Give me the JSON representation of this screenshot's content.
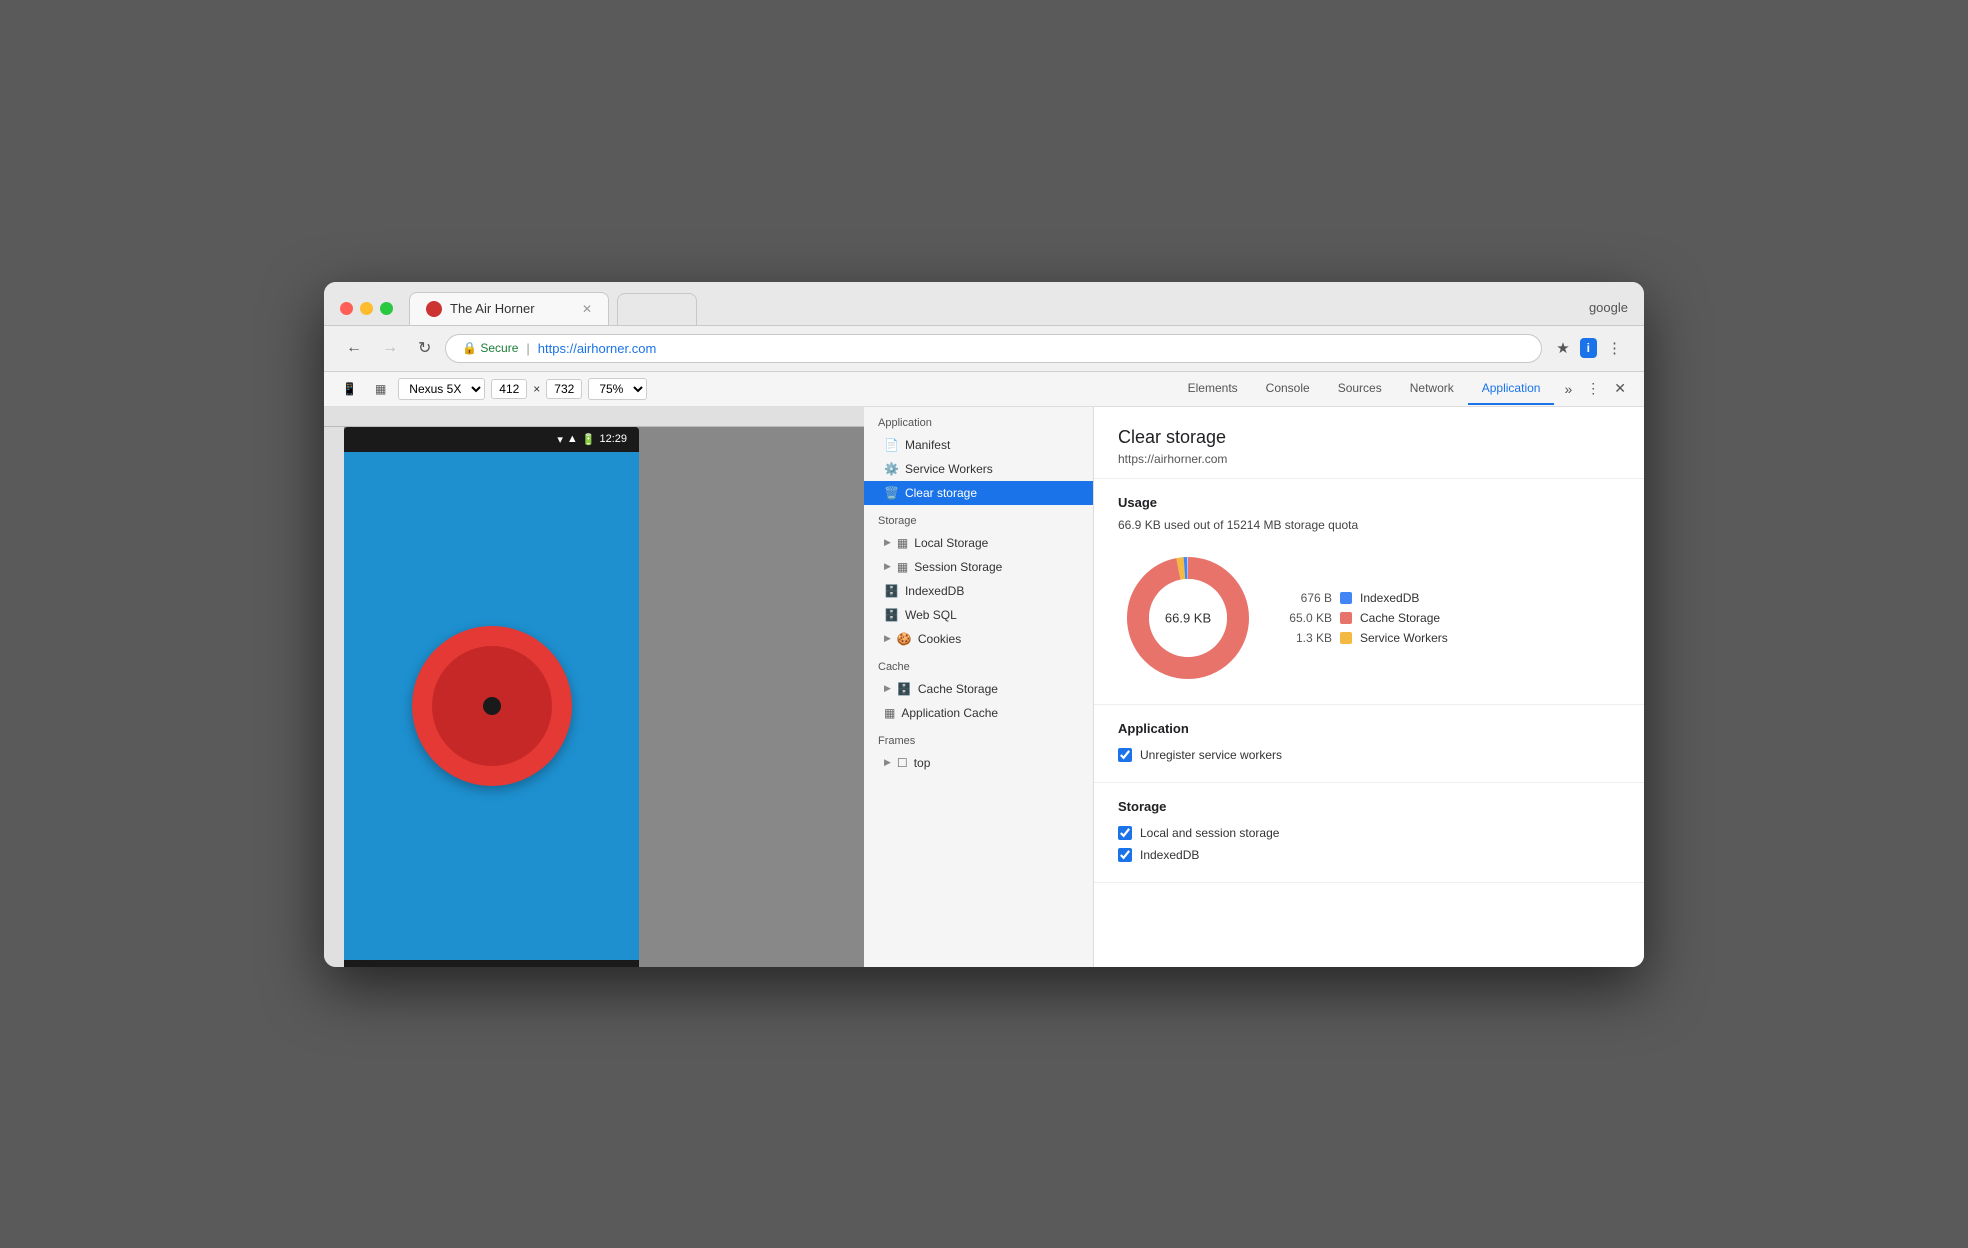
{
  "browser": {
    "title": "The Air Horner",
    "tab_close": "✕",
    "google_account": "google",
    "secure_label": "Secure",
    "url_protocol": "https://",
    "url_host": "airhorner.com",
    "full_url": "https://airhorner.com"
  },
  "toolbar": {
    "device": "Nexus 5X",
    "width": "412",
    "height": "732",
    "zoom": "75%"
  },
  "devtools": {
    "tabs": [
      "Elements",
      "Console",
      "Sources",
      "Network",
      "Application"
    ],
    "active_tab": "Application"
  },
  "sidebar": {
    "application_label": "Application",
    "items_application": [
      {
        "label": "Manifest",
        "icon": "📄"
      },
      {
        "label": "Service Workers",
        "icon": "⚙️"
      },
      {
        "label": "Clear storage",
        "icon": "🗑️",
        "active": true
      }
    ],
    "storage_label": "Storage",
    "items_storage": [
      {
        "label": "Local Storage",
        "icon": "▶",
        "sub": true
      },
      {
        "label": "Session Storage",
        "icon": "▶",
        "sub": true
      },
      {
        "label": "IndexedDB",
        "icon": "🗄️"
      },
      {
        "label": "Web SQL",
        "icon": "🗄️"
      },
      {
        "label": "Cookies",
        "icon": "▶",
        "sub": true
      }
    ],
    "cache_label": "Cache",
    "items_cache": [
      {
        "label": "Cache Storage",
        "icon": "▶",
        "sub": true
      },
      {
        "label": "Application Cache",
        "icon": "▦"
      }
    ],
    "frames_label": "Frames",
    "items_frames": [
      {
        "label": "top",
        "icon": "▶",
        "sub": true
      }
    ]
  },
  "panel": {
    "title": "Clear storage",
    "url": "https://airhorner.com",
    "usage_section_title": "Usage",
    "usage_text": "66.9 KB used out of 15214 MB storage quota",
    "donut_label": "66.9 KB",
    "legend": [
      {
        "size": "676 B",
        "label": "IndexedDB",
        "color": "#4285f4"
      },
      {
        "size": "65.0 KB",
        "label": "Cache Storage",
        "color": "#e8736a"
      },
      {
        "size": "1.3 KB",
        "label": "Service Workers",
        "color": "#f4b942"
      }
    ],
    "application_section_title": "Application",
    "app_checkboxes": [
      {
        "label": "Unregister service workers",
        "checked": true
      }
    ],
    "storage_section_title": "Storage",
    "storage_checkboxes": [
      {
        "label": "Local and session storage",
        "checked": true
      },
      {
        "label": "IndexedDB",
        "checked": true
      }
    ]
  },
  "phone": {
    "time": "12:29"
  }
}
